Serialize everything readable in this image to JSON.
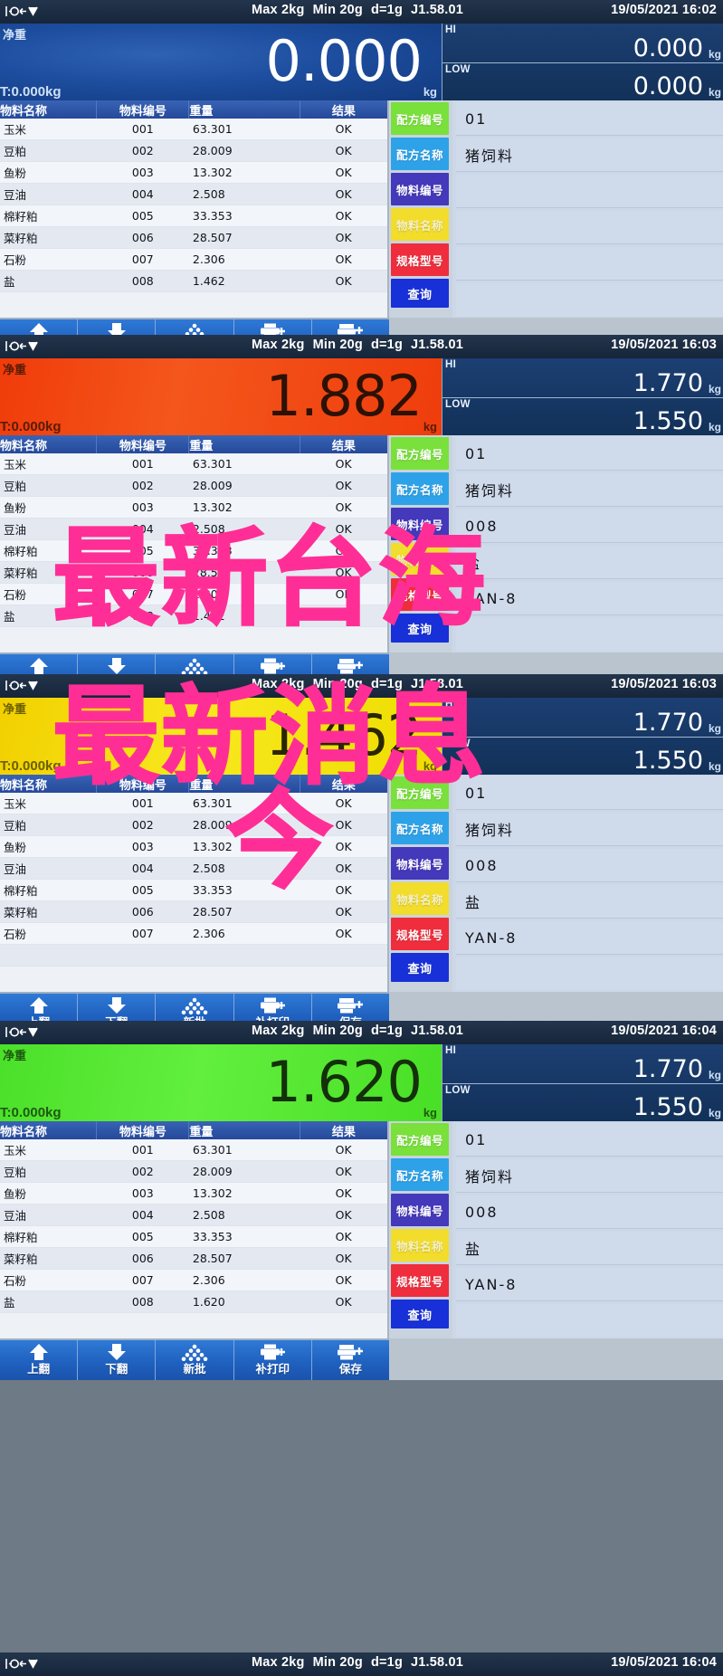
{
  "device": {
    "spec_max": "Max 2kg",
    "spec_min": "Min 20g",
    "spec_d": "d=1g",
    "firmware": "J1.58.01",
    "net_label": "净重",
    "kg_unit": "kg",
    "hi_tag": "HI",
    "low_tag": "LOW",
    "tare_prefix": "T:"
  },
  "table": {
    "headers": [
      "物料名称",
      "物料编号",
      "重量",
      "结果"
    ],
    "rows": [
      {
        "name": "玉米",
        "code": "001",
        "weight": "63.301",
        "result": "OK"
      },
      {
        "name": "豆粕",
        "code": "002",
        "weight": "28.009",
        "result": "OK"
      },
      {
        "name": "鱼粉",
        "code": "003",
        "weight": "13.302",
        "result": "OK"
      },
      {
        "name": "豆油",
        "code": "004",
        "weight": "2.508",
        "result": "OK"
      },
      {
        "name": "棉籽粕",
        "code": "005",
        "weight": "33.353",
        "result": "OK"
      },
      {
        "name": "菜籽粕",
        "code": "006",
        "weight": "28.507",
        "result": "OK"
      },
      {
        "name": "石粉",
        "code": "007",
        "weight": "2.306",
        "result": "OK"
      },
      {
        "name": "盐",
        "code": "008",
        "weight": "1.462",
        "result": "OK"
      }
    ],
    "rows_p3": [
      {
        "name": "玉米",
        "code": "001",
        "weight": "63.301",
        "result": "OK"
      },
      {
        "name": "豆粕",
        "code": "002",
        "weight": "28.009",
        "result": "OK"
      },
      {
        "name": "鱼粉",
        "code": "003",
        "weight": "13.302",
        "result": "OK"
      },
      {
        "name": "豆油",
        "code": "004",
        "weight": "2.508",
        "result": "OK"
      },
      {
        "name": "棉籽粕",
        "code": "005",
        "weight": "33.353",
        "result": "OK"
      },
      {
        "name": "菜籽粕",
        "code": "006",
        "weight": "28.507",
        "result": "OK"
      },
      {
        "name": "石粉",
        "code": "007",
        "weight": "2.306",
        "result": "OK"
      },
      {
        "name": "",
        "code": "",
        "weight": "",
        "result": ""
      }
    ],
    "rows_p4": [
      {
        "name": "玉米",
        "code": "001",
        "weight": "63.301",
        "result": "OK"
      },
      {
        "name": "豆粕",
        "code": "002",
        "weight": "28.009",
        "result": "OK"
      },
      {
        "name": "鱼粉",
        "code": "003",
        "weight": "13.302",
        "result": "OK"
      },
      {
        "name": "豆油",
        "code": "004",
        "weight": "2.508",
        "result": "OK"
      },
      {
        "name": "棉籽粕",
        "code": "005",
        "weight": "33.353",
        "result": "OK"
      },
      {
        "name": "菜籽粕",
        "code": "006",
        "weight": "28.507",
        "result": "OK"
      },
      {
        "name": "石粉",
        "code": "007",
        "weight": "2.306",
        "result": "OK"
      },
      {
        "name": "盐",
        "code": "008",
        "weight": "1.620",
        "result": "OK"
      }
    ]
  },
  "keys": {
    "recipe_no": "配方编号",
    "recipe_name": "配方名称",
    "material_no": "物料编号",
    "material_name": "物料名称",
    "spec_model": "规格型号",
    "query": "查询"
  },
  "toolbar": {
    "page_up": "上翻",
    "page_down": "下翻",
    "new_batch": "新批",
    "reprint": "补打印",
    "save": "保存"
  },
  "colors": {
    "key_recipe_no": "#79e03c",
    "key_recipe_name": "#2ea2e8",
    "key_material_no": "#4438bb",
    "key_material_name": "#f2dc2c",
    "key_spec_model": "#ef2d3c",
    "key_query": "#1730d8",
    "header_blue": "#2d55a6",
    "display_blue": "#1d4d9e",
    "display_red": "#f03c0a",
    "display_yellow": "#f2d000",
    "display_green": "#4be02a",
    "watermark_pink": "#ff2e96"
  },
  "panels": [
    {
      "id": "panel-1",
      "time": "16:02",
      "date": "19/05/2021",
      "weight": "0.000",
      "tare": "T:0.000kg",
      "bg": "blue",
      "hi": "0.000",
      "low": "0.000",
      "recipe_no": "01",
      "recipe_name": "猪饲料",
      "material_no": "",
      "material_name": "",
      "spec_model": ""
    },
    {
      "id": "panel-2",
      "time": "16:03",
      "date": "19/05/2021",
      "weight": "1.882",
      "tare": "T:0.000kg",
      "bg": "red",
      "hi": "1.770",
      "low": "1.550",
      "recipe_no": "01",
      "recipe_name": "猪饲料",
      "material_no": "008",
      "material_name": "盐",
      "spec_model": "YAN-8"
    },
    {
      "id": "panel-3",
      "time": "16:03",
      "date": "19/05/2021",
      "weight": "1.462",
      "tare": "T:0.000kg",
      "bg": "yellow",
      "hi": "1.770",
      "low": "1.550",
      "recipe_no": "01",
      "recipe_name": "猪饲料",
      "material_no": "008",
      "material_name": "盐",
      "spec_model": "YAN-8"
    },
    {
      "id": "panel-4",
      "time": "16:04",
      "date": "19/05/2021",
      "weight": "1.620",
      "tare": "T:0.000kg",
      "bg": "green",
      "hi": "1.770",
      "low": "1.550",
      "recipe_no": "01",
      "recipe_name": "猪饲料",
      "material_no": "008",
      "material_name": "盐",
      "spec_model": "YAN-8"
    },
    {
      "id": "panel-5",
      "time": "16:04",
      "date": "19/05/2021",
      "weight": "",
      "tare": "",
      "bg": "blue",
      "hi": "",
      "low": "",
      "recipe_no": "",
      "recipe_name": "",
      "material_no": "",
      "material_name": "",
      "spec_model": ""
    }
  ],
  "watermark": {
    "line1": "最新台海",
    "line2": "最新消息",
    "line3": "今"
  }
}
